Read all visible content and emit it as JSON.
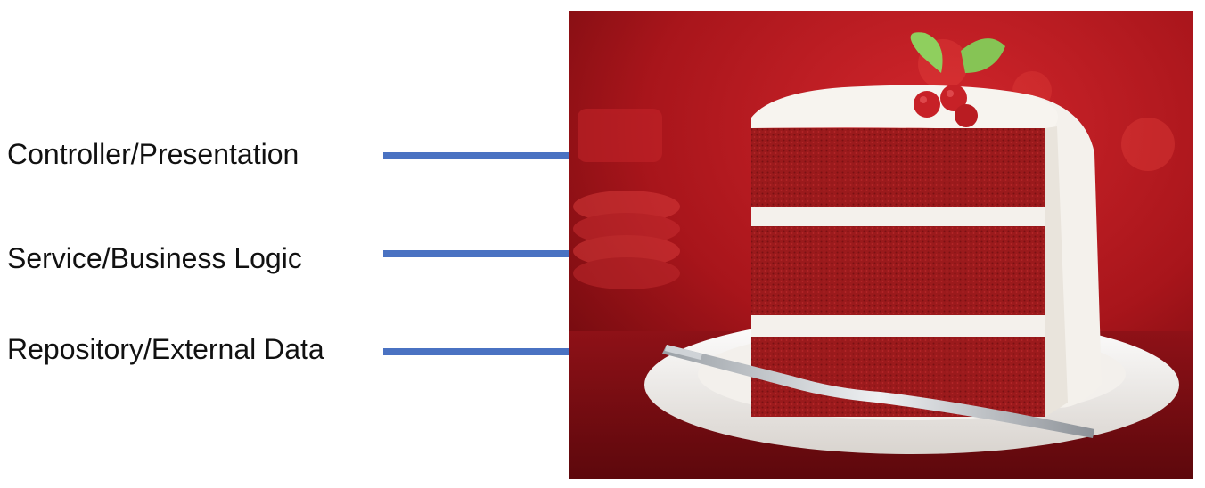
{
  "layers": [
    {
      "label": "Controller/Presentation"
    },
    {
      "label": "Service/Business Logic"
    },
    {
      "label": "Repository/External Data"
    }
  ],
  "photo": {
    "subject": "red-velvet-layer-cake-slice"
  },
  "colors": {
    "arrow": "#4a72c2",
    "cake": "#9e1b1d",
    "frosting": "#f4f1ec",
    "background": "#b01a20"
  }
}
